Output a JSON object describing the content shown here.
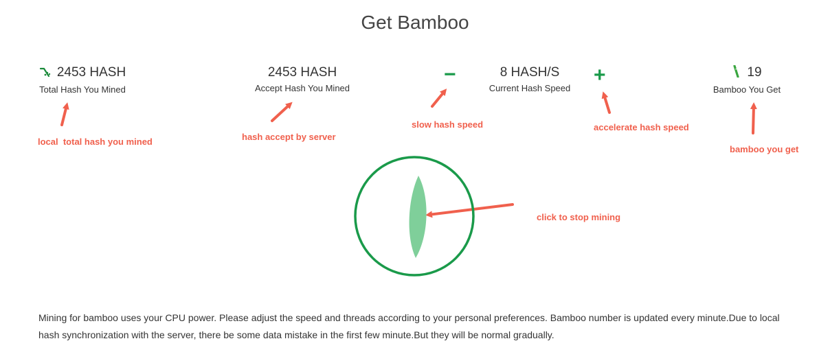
{
  "page": {
    "title": "Get Bamboo"
  },
  "stats": {
    "total_hash": {
      "value": "2453 HASH",
      "label": "Total Hash You Mined",
      "icon": "pickaxe-icon"
    },
    "accept_hash": {
      "value": "2453 HASH",
      "label": "Accept Hash You Mined"
    },
    "speed": {
      "value": "8 HASH/S",
      "label": "Current Hash Speed"
    },
    "bamboo": {
      "value": "19",
      "label": "Bamboo You Get",
      "icon": "bamboo-icon"
    }
  },
  "controls": {
    "decrease_symbol": "−",
    "increase_symbol": "+"
  },
  "annotations": {
    "total_hash": "local  total hash you mined",
    "accept_hash": "hash accept by server",
    "slow": "slow hash speed",
    "accelerate": "accelerate hash speed",
    "bamboo": "bamboo you get",
    "stop": "click to stop mining"
  },
  "description": "Mining for bamboo uses your CPU power. Please adjust the speed and threads according to your personal preferences. Bamboo number is updated every minute.Due to local hash synchronization with the server, there be some data mistake in the first few minute.But they will be normal gradually.",
  "colors": {
    "green": "#1a9a4a",
    "leaf": "#7fcf9a",
    "annotation": "#f0604d"
  }
}
